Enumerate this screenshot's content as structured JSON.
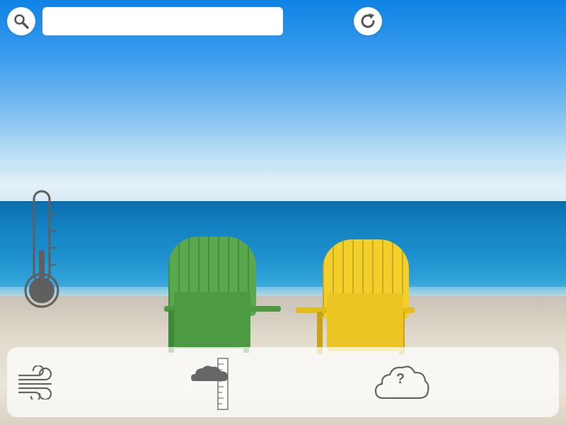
{
  "search": {
    "value": "",
    "placeholder": "",
    "icon": "search-icon"
  },
  "refresh": {
    "icon": "refresh-icon"
  },
  "thermometer": {
    "icon": "thermometer-icon",
    "level": 0.4
  },
  "conditions": [
    {
      "icon": "wind-icon"
    },
    {
      "icon": "cloud-rain-gauge-icon"
    },
    {
      "icon": "unknown-weather-icon",
      "symbol": "?"
    }
  ],
  "colors": {
    "icon_gray": "#5f5f5f",
    "panel_bg": "#ffffff",
    "chair_green": "#5aa84e",
    "chair_yellow": "#f3cf2a"
  }
}
